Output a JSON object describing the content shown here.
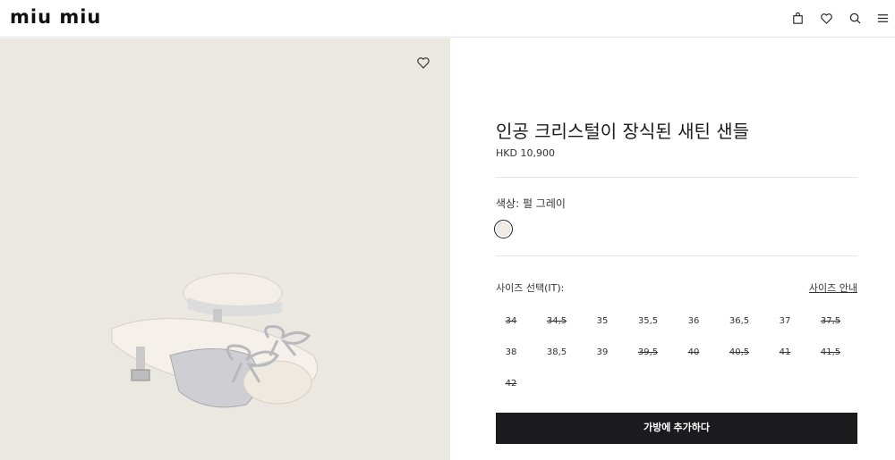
{
  "header": {
    "logo": "miu miu",
    "icons": [
      "bag-icon",
      "heart-icon",
      "search-icon",
      "menu-icon"
    ]
  },
  "product": {
    "title": "인공 크리스털이 장식된 새틴 샌들",
    "price": "HKD 10,900",
    "color_label": "색상:  펄 그레이",
    "swatch_color": "#f1ede6",
    "size_label": "사이즈 선택(IT):",
    "size_guide": "사이즈 안내",
    "sizes": [
      {
        "label": "34",
        "available": false
      },
      {
        "label": "34,5",
        "available": false
      },
      {
        "label": "35",
        "available": true
      },
      {
        "label": "35,5",
        "available": true
      },
      {
        "label": "36",
        "available": true
      },
      {
        "label": "36,5",
        "available": true
      },
      {
        "label": "37",
        "available": true
      },
      {
        "label": "37,5",
        "available": false
      },
      {
        "label": "38",
        "available": true
      },
      {
        "label": "38,5",
        "available": true
      },
      {
        "label": "39",
        "available": true
      },
      {
        "label": "39,5",
        "available": false
      },
      {
        "label": "40",
        "available": false
      },
      {
        "label": "40,5",
        "available": false
      },
      {
        "label": "41",
        "available": false
      },
      {
        "label": "41,5",
        "available": false
      },
      {
        "label": "42",
        "available": false
      }
    ],
    "add_to_bag": "가방에 추가하다"
  },
  "colors": {
    "image_bg": "#ebe7e1",
    "button_bg": "#1b1b1d"
  }
}
